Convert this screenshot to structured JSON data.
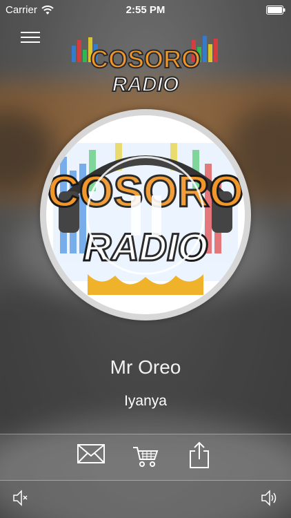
{
  "status_bar": {
    "carrier": "Carrier",
    "time": "2:55 PM",
    "wifi_icon": "wifi-icon",
    "battery_icon": "battery-icon"
  },
  "header": {
    "menu_icon": "hamburger-menu-icon",
    "logo_text_top": "COSORO",
    "logo_text_bottom": "RADIO"
  },
  "player": {
    "cover_text_top": "COSORO",
    "cover_text_bottom": "RADIO",
    "state_icon": "pause-icon"
  },
  "track": {
    "artist": "Mr Oreo",
    "title": "Iyanya"
  },
  "actions": {
    "mail_icon": "mail-icon",
    "cart_icon": "shopping-cart-icon",
    "share_icon": "share-icon"
  },
  "volume": {
    "mute_icon": "volume-mute-icon",
    "up_icon": "volume-up-icon"
  },
  "colors": {
    "logo_orange": "#f0962a",
    "logo_dark": "#2a2a2a",
    "disc_rim": "#d7d7d7"
  }
}
